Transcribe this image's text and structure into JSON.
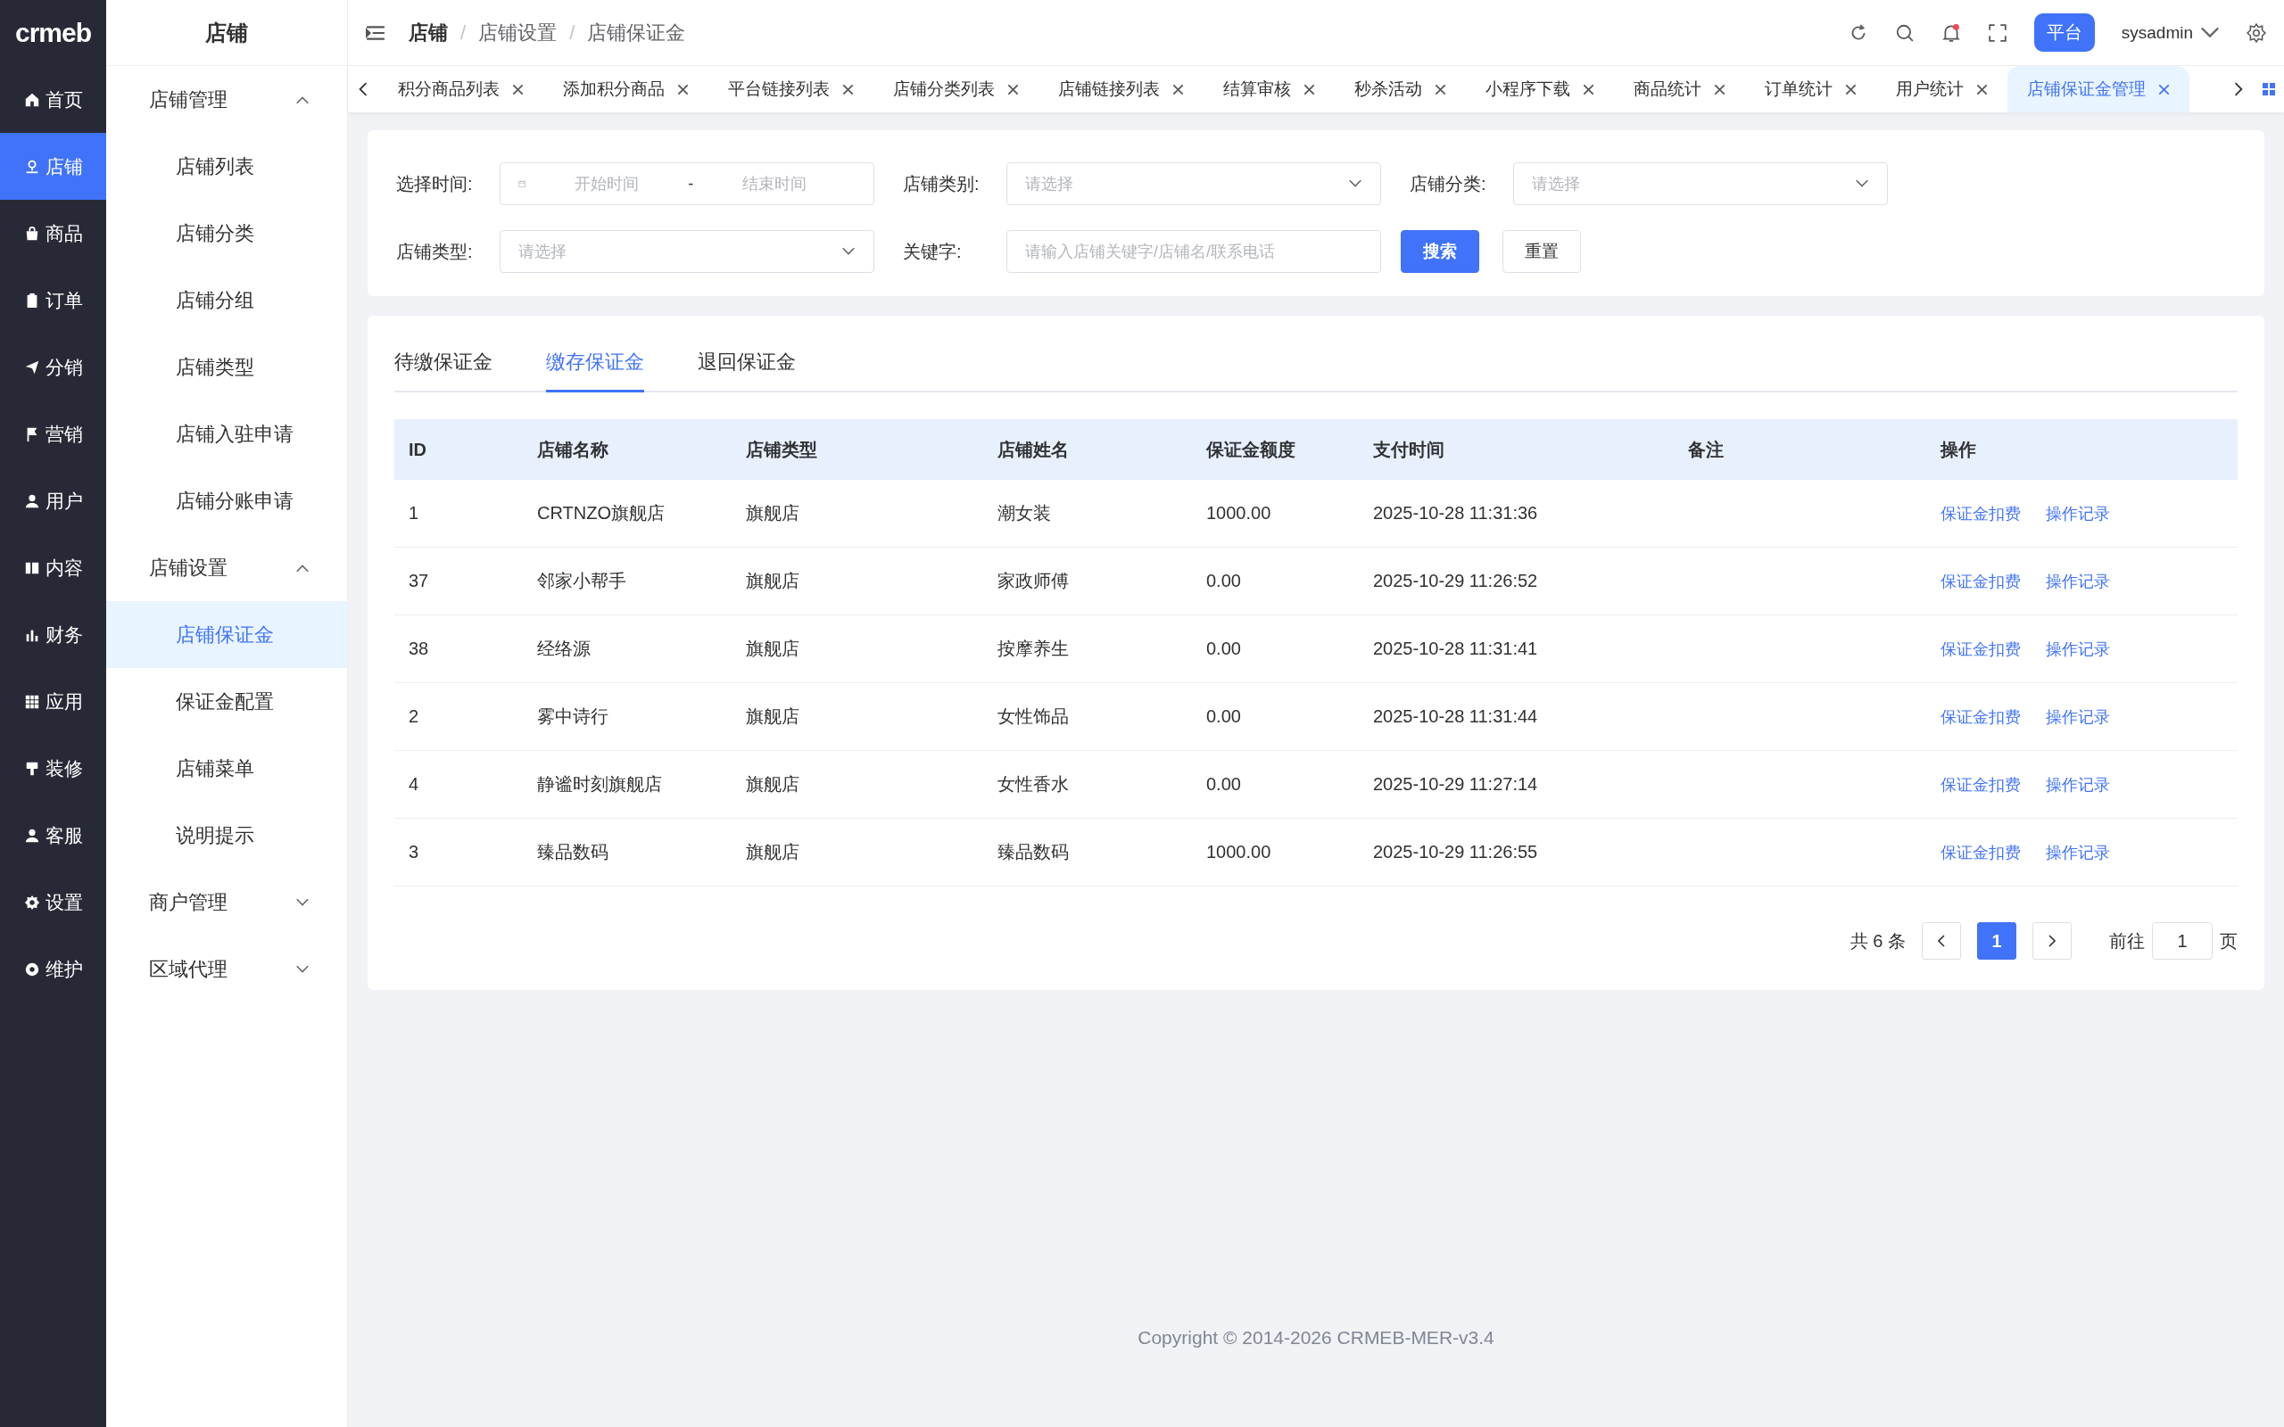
{
  "logo": "crmeb",
  "rail": [
    {
      "label": "首页",
      "selected": false
    },
    {
      "label": "店铺",
      "selected": true
    },
    {
      "label": "商品",
      "selected": false
    },
    {
      "label": "订单",
      "selected": false
    },
    {
      "label": "分销",
      "selected": false
    },
    {
      "label": "营销",
      "selected": false
    },
    {
      "label": "用户",
      "selected": false
    },
    {
      "label": "内容",
      "selected": false
    },
    {
      "label": "财务",
      "selected": false
    },
    {
      "label": "应用",
      "selected": false
    },
    {
      "label": "装修",
      "selected": false
    },
    {
      "label": "客服",
      "selected": false
    },
    {
      "label": "设置",
      "selected": false
    },
    {
      "label": "维护",
      "selected": false
    }
  ],
  "sidebar": {
    "title": "店铺",
    "groups": [
      {
        "label": "店铺管理",
        "expanded": true,
        "children": [
          {
            "label": "店铺列表",
            "selected": false
          },
          {
            "label": "店铺分类",
            "selected": false
          },
          {
            "label": "店铺分组",
            "selected": false
          },
          {
            "label": "店铺类型",
            "selected": false
          },
          {
            "label": "店铺入驻申请",
            "selected": false
          },
          {
            "label": "店铺分账申请",
            "selected": false
          }
        ]
      },
      {
        "label": "店铺设置",
        "expanded": true,
        "children": [
          {
            "label": "店铺保证金",
            "selected": true
          },
          {
            "label": "保证金配置",
            "selected": false
          },
          {
            "label": "店铺菜单",
            "selected": false
          },
          {
            "label": "说明提示",
            "selected": false
          }
        ]
      },
      {
        "label": "商户管理",
        "expanded": false
      },
      {
        "label": "区域代理",
        "expanded": false
      }
    ]
  },
  "breadcrumb": {
    "separator": "/",
    "items": [
      "店铺",
      "店铺设置",
      "店铺保证金"
    ]
  },
  "header": {
    "platform_badge": "平台",
    "user": "sysadmin",
    "notification_dot": true
  },
  "tabs": [
    {
      "label": "积分商品列表",
      "selected": false
    },
    {
      "label": "添加积分商品",
      "selected": false
    },
    {
      "label": "平台链接列表",
      "selected": false
    },
    {
      "label": "店铺分类列表",
      "selected": false
    },
    {
      "label": "店铺链接列表",
      "selected": false
    },
    {
      "label": "结算审核",
      "selected": false
    },
    {
      "label": "秒杀活动",
      "selected": false
    },
    {
      "label": "小程序下载",
      "selected": false
    },
    {
      "label": "商品统计",
      "selected": false
    },
    {
      "label": "订单统计",
      "selected": false
    },
    {
      "label": "用户统计",
      "selected": false
    },
    {
      "label": "店铺保证金管理",
      "selected": true
    }
  ],
  "filters": {
    "time": {
      "label": "选择时间:",
      "start_placeholder": "开始时间",
      "separator": "-",
      "end_placeholder": "结束时间"
    },
    "fields": [
      {
        "kind": "select",
        "label": "店铺类别:",
        "placeholder": "请选择"
      },
      {
        "kind": "select",
        "label": "店铺分类:",
        "placeholder": "请选择"
      },
      {
        "kind": "select",
        "label": "店铺类型:",
        "placeholder": "请选择"
      },
      {
        "kind": "input",
        "label": "关键字:",
        "placeholder": "请输入店铺关键字/店铺名/联系电话"
      }
    ],
    "search_button": "搜索",
    "reset_button": "重置"
  },
  "sub_tabs": [
    {
      "label": "待缴保证金",
      "selected": false
    },
    {
      "label": "缴存保证金",
      "selected": true
    },
    {
      "label": "退回保证金",
      "selected": false
    }
  ],
  "table": {
    "columns": [
      "ID",
      "店铺名称",
      "店铺类型",
      "店铺姓名",
      "保证金额度",
      "支付时间",
      "备注",
      "操作"
    ],
    "rows": [
      {
        "cells": [
          "1",
          "CRTNZO旗舰店",
          "旗舰店",
          "潮女装",
          "1000.00",
          "2025-10-28 11:31:36"
        ],
        "actions": [
          "保证金扣费",
          "操作记录"
        ]
      },
      {
        "cells": [
          "37",
          "邻家小帮手",
          "旗舰店",
          "家政师傅",
          "0.00",
          "2025-10-29 11:26:52"
        ],
        "actions": [
          "保证金扣费",
          "操作记录"
        ]
      },
      {
        "cells": [
          "38",
          "经络源",
          "旗舰店",
          "按摩养生",
          "0.00",
          "2025-10-28 11:31:41"
        ],
        "actions": [
          "保证金扣费",
          "操作记录"
        ]
      },
      {
        "cells": [
          "2",
          "雾中诗行",
          "旗舰店",
          "女性饰品",
          "0.00",
          "2025-10-28 11:31:44"
        ],
        "actions": [
          "保证金扣费",
          "操作记录"
        ]
      },
      {
        "cells": [
          "4",
          "静谧时刻旗舰店",
          "旗舰店",
          "女性香水",
          "0.00",
          "2025-10-29 11:27:14"
        ],
        "actions": [
          "保证金扣费",
          "操作记录"
        ]
      },
      {
        "cells": [
          "3",
          "臻品数码",
          "旗舰店",
          "臻品数码",
          "1000.00",
          "2025-10-29 11:26:55"
        ],
        "actions": [
          "保证金扣费",
          "操作记录"
        ]
      }
    ]
  },
  "pagination": {
    "total": "共 6 条",
    "pages": [
      {
        "label": "1",
        "selected": true
      }
    ],
    "goto_label": "前往",
    "goto_value": "1",
    "page_suffix": "页"
  },
  "footer": "Copyright © 2014-2026 CRMEB-MER-v3.4"
}
